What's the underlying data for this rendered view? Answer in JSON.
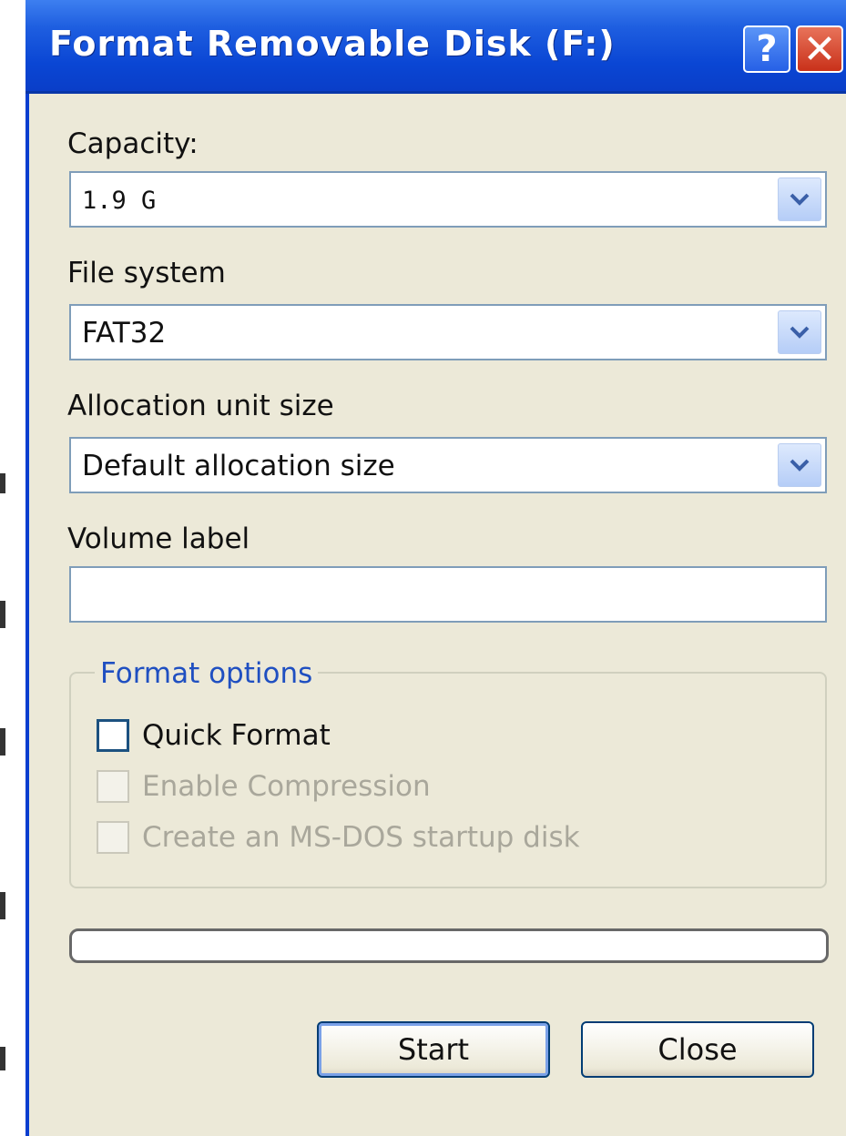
{
  "window": {
    "title": "Format Removable Disk (F:)",
    "help_label": "?",
    "close_label": "✕"
  },
  "capacity": {
    "label": "Capacity:",
    "value": "1.9 G"
  },
  "file_system": {
    "label": "File system",
    "value": "FAT32"
  },
  "allocation_unit": {
    "label": "Allocation unit size",
    "value": "Default allocation size"
  },
  "volume_label": {
    "label": "Volume label",
    "value": ""
  },
  "format_options": {
    "legend": "Format options",
    "quick_format": {
      "label": "Quick Format",
      "checked": false,
      "enabled": true
    },
    "enable_compression": {
      "label": "Enable Compression",
      "checked": false,
      "enabled": false
    },
    "ms_dos_startup": {
      "label": "Create an MS-DOS startup disk",
      "checked": false,
      "enabled": false
    }
  },
  "progress": {
    "value": 0
  },
  "buttons": {
    "start": "Start",
    "close": "Close"
  },
  "colors": {
    "title_bar": "#0a46d4",
    "dialog_bg": "#ece9d8",
    "group_legend": "#1f4fc1",
    "close_button": "#c9311a"
  },
  "icons": {
    "dropdown": "chevron-down-icon",
    "help": "help-icon",
    "close": "close-icon"
  }
}
